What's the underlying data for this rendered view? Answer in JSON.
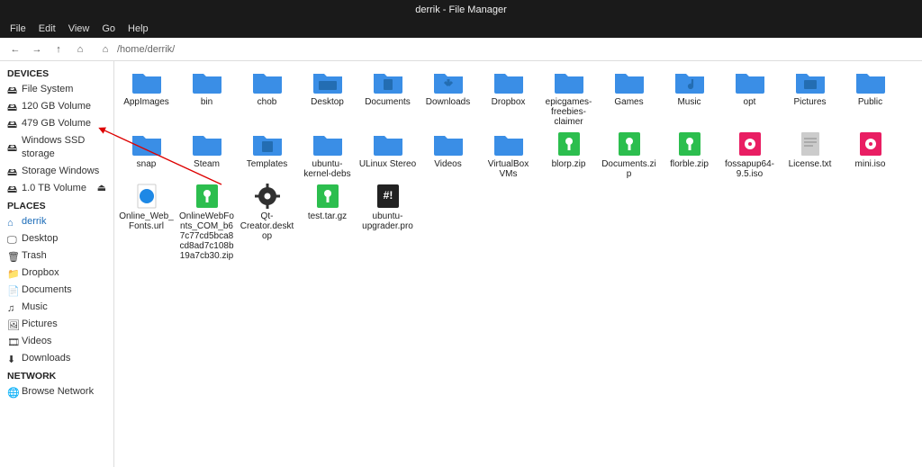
{
  "window": {
    "title": "derrik - File Manager"
  },
  "menu": [
    "File",
    "Edit",
    "View",
    "Go",
    "Help"
  ],
  "path": "/home/derrik/",
  "sidebar": {
    "sections": [
      {
        "header": "DEVICES",
        "items": [
          {
            "label": "File System",
            "icon": "🖴",
            "highlight": false,
            "eject": false
          },
          {
            "label": "120 GB Volume",
            "icon": "🖴",
            "highlight": false,
            "eject": false
          },
          {
            "label": "479 GB Volume",
            "icon": "🖴",
            "highlight": false,
            "eject": false
          },
          {
            "label": "Windows SSD storage",
            "icon": "🖴",
            "highlight": false,
            "eject": false
          },
          {
            "label": "Storage Windows",
            "icon": "🖴",
            "highlight": false,
            "eject": false
          },
          {
            "label": "1.0 TB Volume",
            "icon": "🖴",
            "highlight": false,
            "eject": true
          }
        ]
      },
      {
        "header": "PLACES",
        "items": [
          {
            "label": "derrik",
            "icon": "⌂",
            "highlight": true,
            "eject": false
          },
          {
            "label": "Desktop",
            "icon": "🖵",
            "highlight": false,
            "eject": false
          },
          {
            "label": "Trash",
            "icon": "🗑",
            "highlight": false,
            "eject": false
          },
          {
            "label": "Dropbox",
            "icon": "📁",
            "highlight": false,
            "eject": false
          },
          {
            "label": "Documents",
            "icon": "📄",
            "highlight": false,
            "eject": false
          },
          {
            "label": "Music",
            "icon": "♫",
            "highlight": false,
            "eject": false
          },
          {
            "label": "Pictures",
            "icon": "🖼",
            "highlight": false,
            "eject": false
          },
          {
            "label": "Videos",
            "icon": "🎞",
            "highlight": false,
            "eject": false
          },
          {
            "label": "Downloads",
            "icon": "⬇",
            "highlight": false,
            "eject": false
          }
        ]
      },
      {
        "header": "NETWORK",
        "items": [
          {
            "label": "Browse Network",
            "icon": "🌐",
            "highlight": false,
            "eject": false
          }
        ]
      }
    ]
  },
  "files": [
    {
      "name": "AppImages",
      "type": "folder"
    },
    {
      "name": "bin",
      "type": "folder"
    },
    {
      "name": "chob",
      "type": "folder"
    },
    {
      "name": "Desktop",
      "type": "folder-desktop"
    },
    {
      "name": "Documents",
      "type": "folder-docs"
    },
    {
      "name": "Downloads",
      "type": "folder-down"
    },
    {
      "name": "Dropbox",
      "type": "folder"
    },
    {
      "name": "epicgames-freebies-claimer",
      "type": "folder"
    },
    {
      "name": "Games",
      "type": "folder"
    },
    {
      "name": "Music",
      "type": "folder-music"
    },
    {
      "name": "opt",
      "type": "folder"
    },
    {
      "name": "Pictures",
      "type": "folder-pics"
    },
    {
      "name": "Public",
      "type": "folder"
    },
    {
      "name": "snap",
      "type": "folder"
    },
    {
      "name": "Steam",
      "type": "folder"
    },
    {
      "name": "Templates",
      "type": "folder-temp"
    },
    {
      "name": "ubuntu-kernel-debs",
      "type": "folder"
    },
    {
      "name": "ULinux Stereo",
      "type": "folder"
    },
    {
      "name": "Videos",
      "type": "folder"
    },
    {
      "name": "VirtualBox VMs",
      "type": "folder"
    },
    {
      "name": "blorp.zip",
      "type": "zip"
    },
    {
      "name": "Documents.zip",
      "type": "zip"
    },
    {
      "name": "florble.zip",
      "type": "zip"
    },
    {
      "name": "fossapup64-9.5.iso",
      "type": "iso"
    },
    {
      "name": "License.txt",
      "type": "txt"
    },
    {
      "name": "mini.iso",
      "type": "iso"
    },
    {
      "name": "Online_Web_Fonts.url",
      "type": "url"
    },
    {
      "name": "OnlineWebFonts_COM_b67c77cd5bca8cd8ad7c108b19a7cb30.zip",
      "type": "zip"
    },
    {
      "name": "Qt-Creator.desktop",
      "type": "app"
    },
    {
      "name": "test.tar.gz",
      "type": "zip"
    },
    {
      "name": "ubuntu-upgrader.pro",
      "type": "script"
    }
  ]
}
